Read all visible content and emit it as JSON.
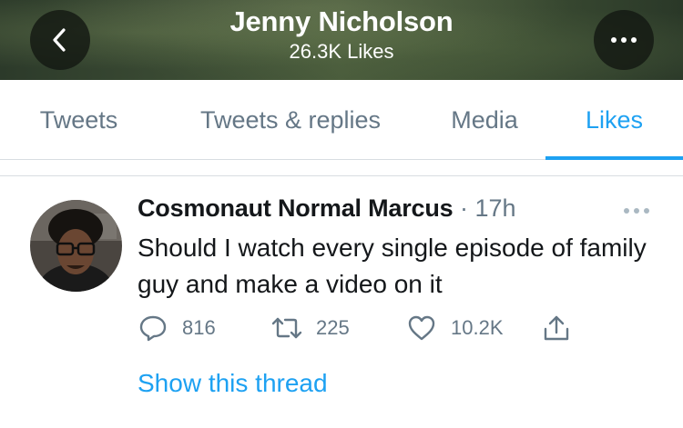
{
  "header": {
    "title": "Jenny Nicholson",
    "subtitle": "26.3K Likes",
    "back_icon": "chevron-left-icon",
    "more_icon": "more-horizontal-icon"
  },
  "tabs": [
    {
      "label": "Tweets",
      "active": false
    },
    {
      "label": "Tweets & replies",
      "active": false
    },
    {
      "label": "Media",
      "active": false
    },
    {
      "label": "Likes",
      "active": true
    }
  ],
  "tweet": {
    "author": "Cosmonaut Normal Marcus",
    "separator": "·",
    "time": "17h",
    "text": "Should I watch every single episode of family guy and make a video on it",
    "replies": "816",
    "retweets": "225",
    "likes": "10.2K",
    "show_thread": "Show this thread"
  },
  "colors": {
    "accent": "#1da1f2",
    "secondary_text": "#657786",
    "primary_text": "#14171a"
  }
}
